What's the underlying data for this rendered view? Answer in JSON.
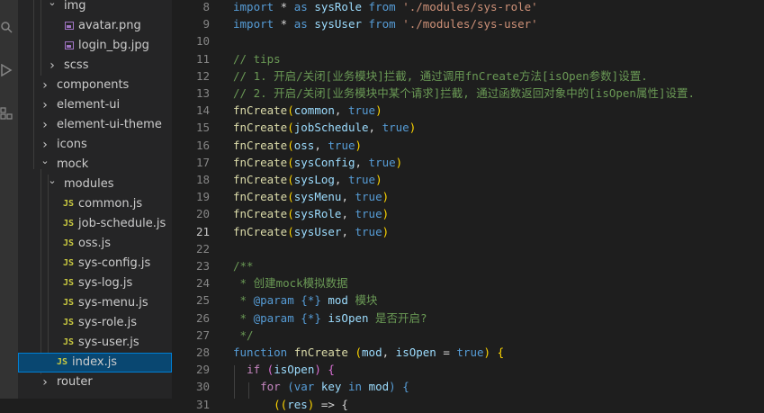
{
  "explorer": {
    "items": [
      {
        "label": "img",
        "depth": 2,
        "type": "folder-open"
      },
      {
        "label": "avatar.png",
        "depth": 3,
        "type": "image"
      },
      {
        "label": "login_bg.jpg",
        "depth": 3,
        "type": "image"
      },
      {
        "label": "scss",
        "depth": 2,
        "type": "folder"
      },
      {
        "label": "components",
        "depth": 1,
        "type": "folder"
      },
      {
        "label": "element-ui",
        "depth": 1,
        "type": "folder"
      },
      {
        "label": "element-ui-theme",
        "depth": 1,
        "type": "folder"
      },
      {
        "label": "icons",
        "depth": 1,
        "type": "folder"
      },
      {
        "label": "mock",
        "depth": 1,
        "type": "folder-open"
      },
      {
        "label": "modules",
        "depth": 2,
        "type": "folder-open"
      },
      {
        "label": "common.js",
        "depth": 3,
        "type": "js"
      },
      {
        "label": "job-schedule.js",
        "depth": 3,
        "type": "js"
      },
      {
        "label": "oss.js",
        "depth": 3,
        "type": "js"
      },
      {
        "label": "sys-config.js",
        "depth": 3,
        "type": "js"
      },
      {
        "label": "sys-log.js",
        "depth": 3,
        "type": "js"
      },
      {
        "label": "sys-menu.js",
        "depth": 3,
        "type": "js"
      },
      {
        "label": "sys-role.js",
        "depth": 3,
        "type": "js"
      },
      {
        "label": "sys-user.js",
        "depth": 3,
        "type": "js"
      },
      {
        "label": "index.js",
        "depth": 2,
        "type": "js",
        "selected": true
      },
      {
        "label": "router",
        "depth": 1,
        "type": "folder"
      }
    ],
    "js_badge": "JS"
  },
  "editor": {
    "active_line": 21,
    "lines": [
      {
        "n": "8",
        "tokens": [
          [
            "k",
            "import"
          ],
          [
            "p",
            " * "
          ],
          [
            "k",
            "as"
          ],
          [
            "p",
            " "
          ],
          [
            "v",
            "sysRole"
          ],
          [
            "p",
            " "
          ],
          [
            "k",
            "from"
          ],
          [
            "p",
            " "
          ],
          [
            "s",
            "'./modules/sys-role'"
          ]
        ]
      },
      {
        "n": "9",
        "tokens": [
          [
            "k",
            "import"
          ],
          [
            "p",
            " * "
          ],
          [
            "k",
            "as"
          ],
          [
            "p",
            " "
          ],
          [
            "v",
            "sysUser"
          ],
          [
            "p",
            " "
          ],
          [
            "k",
            "from"
          ],
          [
            "p",
            " "
          ],
          [
            "s",
            "'./modules/sys-user'"
          ]
        ]
      },
      {
        "n": "10",
        "tokens": []
      },
      {
        "n": "11",
        "tokens": [
          [
            "c",
            "// tips"
          ]
        ]
      },
      {
        "n": "12",
        "tokens": [
          [
            "c",
            "// 1. 开启/关闭[业务模块]拦截, 通过调用fnCreate方法[isOpen参数]设置."
          ]
        ]
      },
      {
        "n": "13",
        "tokens": [
          [
            "c",
            "// 2. 开启/关闭[业务模块中某个请求]拦截, 通过函数返回对象中的[isOpen属性]设置."
          ]
        ]
      },
      {
        "n": "14",
        "tokens": [
          [
            "f",
            "fnCreate"
          ],
          [
            "b",
            "("
          ],
          [
            "v",
            "common"
          ],
          [
            "p",
            ", "
          ],
          [
            "d",
            "true"
          ],
          [
            "b",
            ")"
          ]
        ]
      },
      {
        "n": "15",
        "tokens": [
          [
            "f",
            "fnCreate"
          ],
          [
            "b",
            "("
          ],
          [
            "v",
            "jobSchedule"
          ],
          [
            "p",
            ", "
          ],
          [
            "d",
            "true"
          ],
          [
            "b",
            ")"
          ]
        ]
      },
      {
        "n": "16",
        "tokens": [
          [
            "f",
            "fnCreate"
          ],
          [
            "b",
            "("
          ],
          [
            "v",
            "oss"
          ],
          [
            "p",
            ", "
          ],
          [
            "d",
            "true"
          ],
          [
            "b",
            ")"
          ]
        ]
      },
      {
        "n": "17",
        "tokens": [
          [
            "f",
            "fnCreate"
          ],
          [
            "b",
            "("
          ],
          [
            "v",
            "sysConfig"
          ],
          [
            "p",
            ", "
          ],
          [
            "d",
            "true"
          ],
          [
            "b",
            ")"
          ]
        ]
      },
      {
        "n": "18",
        "tokens": [
          [
            "f",
            "fnCreate"
          ],
          [
            "b",
            "("
          ],
          [
            "v",
            "sysLog"
          ],
          [
            "p",
            ", "
          ],
          [
            "d",
            "true"
          ],
          [
            "b",
            ")"
          ]
        ]
      },
      {
        "n": "19",
        "tokens": [
          [
            "f",
            "fnCreate"
          ],
          [
            "b",
            "("
          ],
          [
            "v",
            "sysMenu"
          ],
          [
            "p",
            ", "
          ],
          [
            "d",
            "true"
          ],
          [
            "b",
            ")"
          ]
        ]
      },
      {
        "n": "20",
        "tokens": [
          [
            "f",
            "fnCreate"
          ],
          [
            "b",
            "("
          ],
          [
            "v",
            "sysRole"
          ],
          [
            "p",
            ", "
          ],
          [
            "d",
            "true"
          ],
          [
            "b",
            ")"
          ]
        ]
      },
      {
        "n": "21",
        "tokens": [
          [
            "f",
            "fnCreate"
          ],
          [
            "b",
            "("
          ],
          [
            "v",
            "sysUser"
          ],
          [
            "p",
            ", "
          ],
          [
            "d",
            "true"
          ],
          [
            "b",
            ")"
          ]
        ]
      },
      {
        "n": "22",
        "tokens": []
      },
      {
        "n": "23",
        "tokens": [
          [
            "c",
            "/**"
          ]
        ]
      },
      {
        "n": "24",
        "tokens": [
          [
            "c",
            " * 创建mock模拟数据"
          ]
        ]
      },
      {
        "n": "25",
        "tokens": [
          [
            "c",
            " * "
          ],
          [
            "d",
            "@param"
          ],
          [
            "c",
            " "
          ],
          [
            "d",
            "{*}"
          ],
          [
            "c",
            " "
          ],
          [
            "v",
            "mod"
          ],
          [
            "c",
            " 模块"
          ]
        ]
      },
      {
        "n": "26",
        "tokens": [
          [
            "c",
            " * "
          ],
          [
            "d",
            "@param"
          ],
          [
            "c",
            " "
          ],
          [
            "d",
            "{*}"
          ],
          [
            "c",
            " "
          ],
          [
            "v",
            "isOpen"
          ],
          [
            "c",
            " 是否开启?"
          ]
        ]
      },
      {
        "n": "27",
        "tokens": [
          [
            "c",
            " */"
          ]
        ]
      },
      {
        "n": "28",
        "tokens": [
          [
            "k",
            "function"
          ],
          [
            "p",
            " "
          ],
          [
            "f",
            "fnCreate"
          ],
          [
            "p",
            " "
          ],
          [
            "b",
            "("
          ],
          [
            "v",
            "mod"
          ],
          [
            "p",
            ", "
          ],
          [
            "v",
            "isOpen"
          ],
          [
            "p",
            " = "
          ],
          [
            "d",
            "true"
          ],
          [
            "b",
            ")"
          ],
          [
            "p",
            " "
          ],
          [
            "b",
            "{"
          ]
        ]
      },
      {
        "n": "29",
        "tokens": [
          [
            "p",
            "  "
          ],
          [
            "kc",
            "if"
          ],
          [
            "p",
            " "
          ],
          [
            "b2",
            "("
          ],
          [
            "v",
            "isOpen"
          ],
          [
            "b2",
            ")"
          ],
          [
            "p",
            " "
          ],
          [
            "b2",
            "{"
          ]
        ]
      },
      {
        "n": "30",
        "tokens": [
          [
            "p",
            "    "
          ],
          [
            "kc",
            "for"
          ],
          [
            "p",
            " "
          ],
          [
            "k",
            "("
          ],
          [
            "k",
            "var"
          ],
          [
            "p",
            " "
          ],
          [
            "v",
            "key"
          ],
          [
            "p",
            " "
          ],
          [
            "k",
            "in"
          ],
          [
            "p",
            " "
          ],
          [
            "v",
            "mod"
          ],
          [
            "k",
            ")"
          ],
          [
            "p",
            " "
          ],
          [
            "k",
            "{"
          ]
        ]
      },
      {
        "n": "31",
        "tokens": [
          [
            "p",
            "      "
          ],
          [
            "b",
            "(("
          ],
          [
            "v",
            "res"
          ],
          [
            "b",
            ")"
          ],
          [
            "p",
            " => {"
          ]
        ]
      }
    ]
  }
}
